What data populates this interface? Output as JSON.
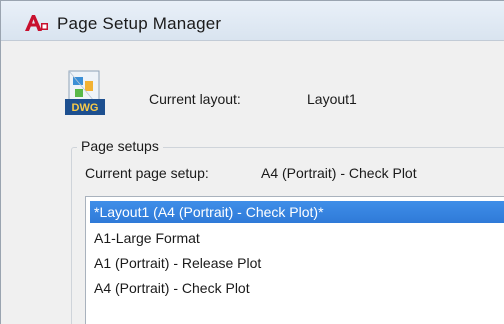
{
  "window": {
    "title": "Page Setup Manager",
    "app_icon": "autocad-a-icon",
    "app_icon_text": "A"
  },
  "current_layout": {
    "label": "Current layout:",
    "value": "Layout1",
    "icon": "dwg-file-icon",
    "icon_text": "DWG"
  },
  "page_setups": {
    "group_label": "Page setups",
    "current_setup_label": "Current page setup:",
    "current_setup_value": "A4 (Portrait) - Check Plot",
    "items": [
      {
        "label": "*Layout1 (A4 (Portrait) - Check Plot)*",
        "selected": true
      },
      {
        "label": "A1-Large Format",
        "selected": false
      },
      {
        "label": "A1 (Portrait) - Release Plot",
        "selected": false
      },
      {
        "label": "A4 (Portrait) - Check Plot",
        "selected": false
      }
    ]
  },
  "colors": {
    "selection": "#3585e0",
    "window_bg": "#f0f0f0",
    "title_bg": "#e0e9f4"
  }
}
